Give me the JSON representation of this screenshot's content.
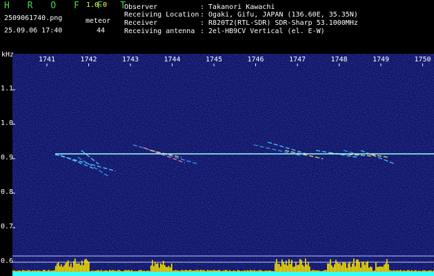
{
  "app": {
    "logo": "H R O F F T",
    "version": "1.0.0"
  },
  "capture": {
    "filename": "2509061740.png",
    "datetime": "25.09.06 17:40",
    "meteor_label": "meteor",
    "meteor_count": "44"
  },
  "station": {
    "rows": [
      {
        "key": "Observer",
        "value": ": Takanori Kawachi"
      },
      {
        "key": "Receiving Location",
        "value": ": Ogaki, Gifu, JAPAN (136.60E, 35.35N)"
      },
      {
        "key": "Receiver",
        "value": ": R820T2(RTL-SDR) SDR-Sharp 53.1000MHz"
      },
      {
        "key": "Receiving antenna",
        "value": ": 2el-HB9CV Vertical (el. E-W)"
      }
    ]
  },
  "spectrogram": {
    "y_unit": "kHz",
    "time_ticks": [
      "1741",
      "1742",
      "1743",
      "1744",
      "1745",
      "1746",
      "1747",
      "1748",
      "1749",
      "1750"
    ],
    "freq_ticks": [
      "1.1",
      "1.0",
      "0.9",
      "0.8",
      "0.7",
      "0.6"
    ],
    "carrier_freq_khz": 0.91,
    "colors": {
      "background": "#0a0a55",
      "carrier": "#9fffff",
      "bars": "#ffe600",
      "noise_floor": "#33ffff"
    }
  }
}
